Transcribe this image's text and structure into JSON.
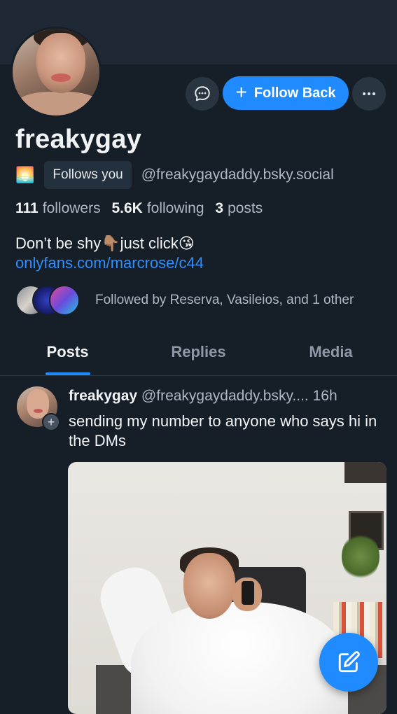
{
  "profile": {
    "display_name": "freakygay",
    "follows_you_label": "Follows you",
    "handle": "@freakygaydaddy.bsky.social",
    "followers_count": "111",
    "followers_label": "followers",
    "following_count": "5.6K",
    "following_label": "following",
    "posts_count": "3",
    "posts_label": "posts",
    "bio_line": "Don’t be shy👇🏽just click😘",
    "bio_link": "onlyfans.com/marcrose/c44",
    "followed_by_text": "Followed by Reserva, Vasileios, and 1 other",
    "status_emoji": "🌅"
  },
  "actions": {
    "follow_back_label": "Follow Back",
    "follow_plus": "+"
  },
  "tabs": [
    {
      "label": "Posts",
      "active": true
    },
    {
      "label": "Replies",
      "active": false
    },
    {
      "label": "Media",
      "active": false
    }
  ],
  "post": {
    "author": "freakygay",
    "handle": "@freakygaydaddy.bsky....",
    "time": "16h",
    "text": "sending my number to anyone who says hi in the DMs",
    "avatar_plus": "+"
  },
  "colors": {
    "accent": "#208bfe",
    "background": "#161e27",
    "link": "#2f8efb"
  },
  "icons": [
    "chat-bubble-icon",
    "more-options-icon",
    "plus-icon",
    "compose-icon",
    "sunrise-emoji"
  ]
}
